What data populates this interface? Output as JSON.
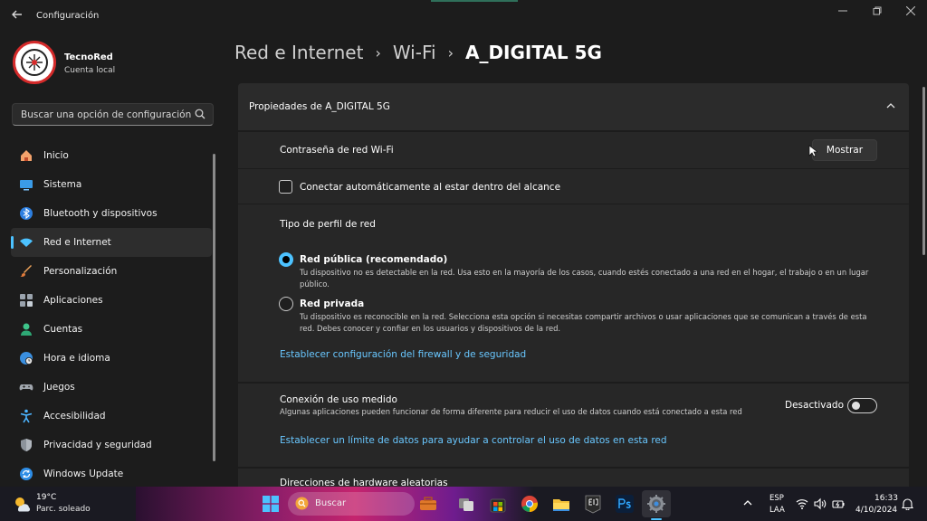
{
  "window": {
    "title": "Configuración",
    "back_icon": "arrow-left-icon",
    "controls": [
      "minimize-icon",
      "restore-icon",
      "close-icon"
    ]
  },
  "profile": {
    "name": "TecnoRed",
    "account_type": "Cuenta local"
  },
  "search": {
    "placeholder": "Buscar una opción de configuración"
  },
  "sidebar": {
    "items": [
      {
        "label": "Inicio",
        "icon": "home-icon",
        "active": false
      },
      {
        "label": "Sistema",
        "icon": "monitor-icon",
        "active": false
      },
      {
        "label": "Bluetooth y dispositivos",
        "icon": "bluetooth-icon",
        "active": false
      },
      {
        "label": "Red e Internet",
        "icon": "wifi-icon",
        "active": true
      },
      {
        "label": "Personalización",
        "icon": "brush-icon",
        "active": false
      },
      {
        "label": "Aplicaciones",
        "icon": "apps-icon",
        "active": false
      },
      {
        "label": "Cuentas",
        "icon": "person-icon",
        "active": false
      },
      {
        "label": "Hora e idioma",
        "icon": "globe-clock-icon",
        "active": false
      },
      {
        "label": "Juegos",
        "icon": "gamepad-icon",
        "active": false
      },
      {
        "label": "Accesibilidad",
        "icon": "accessibility-icon",
        "active": false
      },
      {
        "label": "Privacidad y seguridad",
        "icon": "shield-icon",
        "active": false
      },
      {
        "label": "Windows Update",
        "icon": "update-icon",
        "active": false
      }
    ]
  },
  "breadcrumb": {
    "level1": "Red e Internet",
    "level2": "Wi-Fi",
    "current": "A_DIGITAL 5G",
    "separator": "›"
  },
  "properties": {
    "header": "Propiedades de A_DIGITAL 5G",
    "password_label": "Contraseña de red Wi-Fi",
    "show_button": "Mostrar",
    "auto_connect_label": "Conectar automáticamente al estar dentro del alcance",
    "auto_connect_checked": false,
    "profile_type_label": "Tipo de perfil de red",
    "public": {
      "title": "Red pública (recomendado)",
      "desc": "Tu dispositivo no es detectable en la red. Usa esto en la mayoría de los casos, cuando estés conectado a una red en el hogar, el trabajo o en un lugar público.",
      "selected": true
    },
    "private": {
      "title": "Red privada",
      "desc": "Tu dispositivo es reconocible en la red. Selecciona esta opción si necesitas compartir archivos o usar aplicaciones que se comunican a través de esta red. Debes conocer y confiar en los usuarios y dispositivos de la red.",
      "selected": false
    },
    "firewall_link": "Establecer configuración del firewall y de seguridad"
  },
  "metered": {
    "title": "Conexión de uso medido",
    "desc": "Algunas aplicaciones pueden funcionar de forma diferente para reducir el uso de datos cuando está conectado a esta red",
    "state": "Desactivado",
    "enabled": false,
    "limit_link": "Establecer un límite de datos para ayudar a controlar el uso de datos en esta red"
  },
  "hardware": {
    "title": "Direcciones de hardware aleatorias"
  },
  "taskbar": {
    "weather_temp": "19°C",
    "weather_desc": "Parc. soleado",
    "search_placeholder": "Buscar",
    "apps": [
      "toolbox-icon",
      "task-view-icon",
      "store-icon",
      "chrome-icon",
      "file-explorer-icon",
      "epic-games-icon",
      "photoshop-icon",
      "settings-icon"
    ],
    "lang_line1": "ESP",
    "lang_line2": "LAA",
    "time": "16:33",
    "date": "4/10/2024"
  },
  "colors": {
    "accent": "#4cc2ff",
    "link": "#69c7ff",
    "avatar_ring": "#d42a2a"
  }
}
